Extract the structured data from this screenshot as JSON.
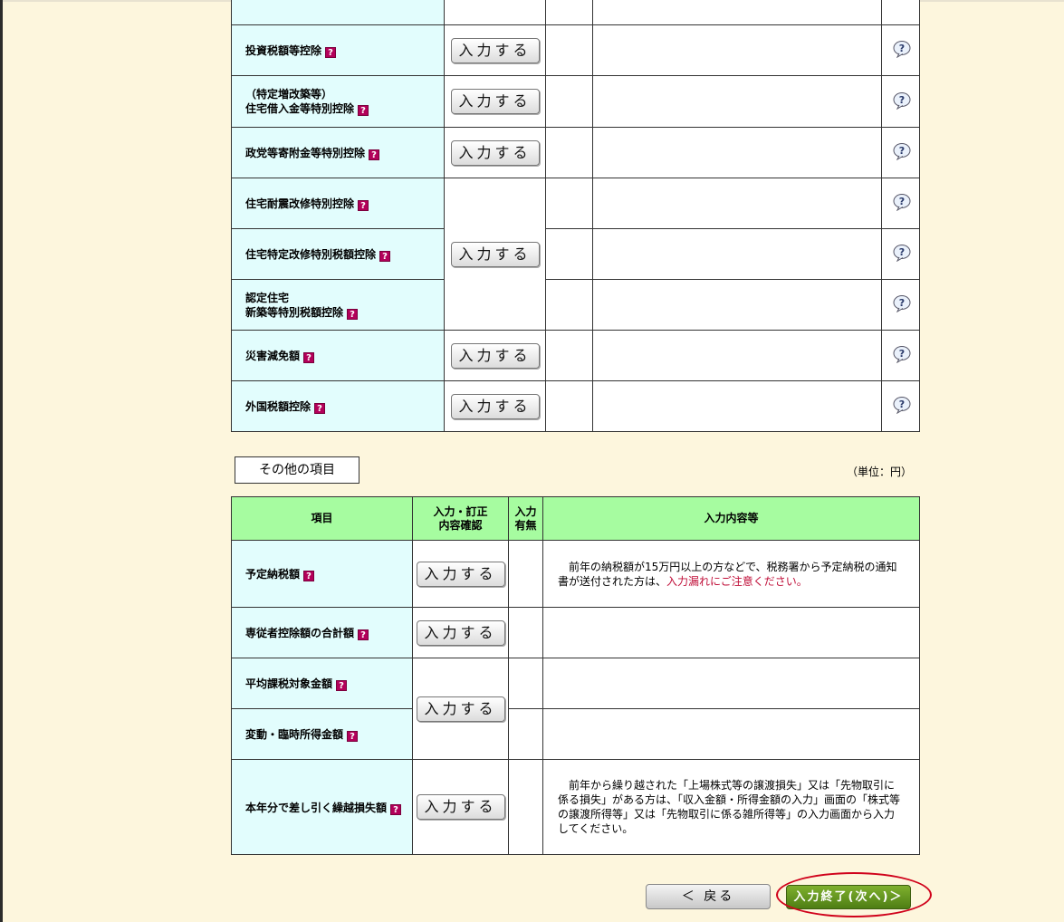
{
  "upper_rows": [
    {
      "label": "",
      "has_button": false
    },
    {
      "label": "投資税額等控除",
      "has_button": true
    },
    {
      "label": "（特定増改築等）\n住宅借入金等特別控除",
      "has_button": true
    },
    {
      "label": "政党等寄附金等特別控除",
      "has_button": true
    },
    {
      "label": "住宅耐震改修特別控除",
      "has_button": true
    },
    {
      "label": "住宅特定改修特別税額控除",
      "has_button": false
    },
    {
      "label": "認定住宅\n新築等特別税額控除",
      "has_button": false
    },
    {
      "label": "災害減免額",
      "has_button": true
    },
    {
      "label": "外国税額控除",
      "has_button": true
    }
  ],
  "input_button_label": "入力する",
  "help_marker": "?",
  "other_section_title": "その他の項目",
  "unit_label": "（単位：円）",
  "lower_headers": {
    "item": "項目",
    "confirm": "入力・訂正\n内容確認",
    "status": "入力\n有無",
    "details": "入力内容等"
  },
  "lower_rows": [
    {
      "label": "予定納税額",
      "note_main": "前年の納税額が15万円以上の方などで、税務署から予定納税の通知書が送付された方は、",
      "note_warn": "入力漏れにご注意ください。"
    },
    {
      "label": "専従者控除額の合計額"
    },
    {
      "label": "平均課税対象金額"
    },
    {
      "label": "変動・臨時所得金額"
    },
    {
      "label": "本年分で差し引く繰越損失額",
      "note_main": "前年から繰り越された「上場株式等の譲渡損失」又は「先物取引に係る損失」がある方は、「収入金額・所得金額の入力」画面の「株式等の譲渡所得等」又は「先物取引に係る雑所得等」の入力画面から入力してください。"
    }
  ],
  "nav": {
    "back_label": "＜ 戻る",
    "next_label": "入力終了(次へ)＞"
  },
  "colors": {
    "page_bg": "#fdf6dd",
    "label_bg": "#e2fdfd",
    "header_bg": "#a6fca0",
    "help_icon": "#b3005a",
    "warn_text": "#c0103a",
    "next_button": "#5e8f1c",
    "highlight": "#d0021b"
  }
}
